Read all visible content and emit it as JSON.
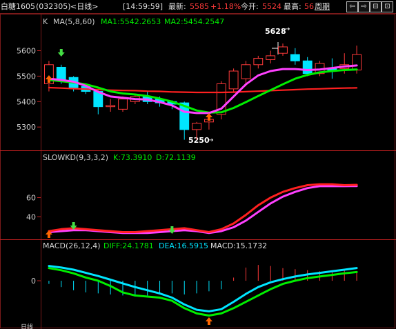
{
  "header": {
    "symbol": "白糖1605",
    "code": "(032305)",
    "period": "<日线>",
    "time": "[14:59:59]",
    "latest_label": "最新:",
    "latest_value": "5585",
    "change": "+1.18%",
    "open_label": "今开:",
    "open_value": "5524",
    "high_label": "最高:",
    "high_value": "56",
    "cycle_label": "周期",
    "nav_buttons": [
      "⇦",
      "⇨",
      "⊟",
      "⊡"
    ]
  },
  "panels": {
    "main_prefix": "K",
    "main_title": "MA(5,8,60)",
    "ma1": "MA1:5542.2653",
    "ma2": "MA2:5454.2547",
    "kd_title": "SLOWKD(9,3,3,2)",
    "kd_k": "K:73.3910",
    "kd_d": "D:72.1139",
    "macd_title": "MACD(26,12,4)",
    "macd_diff": "DIFF:24.1781",
    "macd_dea": "DEA:16.5915",
    "macd_macd": "MACD:15.1732",
    "hi_annotation": "5628",
    "lo_annotation": "5250",
    "bottom_cut_label": "日线"
  },
  "colors": {
    "up": "#ff3a3a",
    "down": "#00e5ff",
    "ma_short": "#ff40ff",
    "ma_mid": "#00ee00",
    "ma_long": "#ff2020",
    "kd_k": "#ff2020",
    "kd_d": "#ff40ff",
    "macd_diff": "#00e5ff",
    "macd_dea": "#00ee00",
    "frame": "#7a1a1a",
    "signal_buy": "#ff6600",
    "signal_sell": "#44dd44"
  },
  "chart_data": [
    {
      "type": "candlestick",
      "ylim": [
        5230,
        5680
      ],
      "yticks": [
        5300,
        5400,
        5500,
        5600
      ],
      "candles": [
        {
          "o": 5470,
          "h": 5560,
          "l": 5440,
          "c": 5545
        },
        {
          "o": 5535,
          "h": 5545,
          "l": 5470,
          "c": 5480
        },
        {
          "o": 5495,
          "h": 5500,
          "l": 5440,
          "c": 5455
        },
        {
          "o": 5460,
          "h": 5470,
          "l": 5430,
          "c": 5440
        },
        {
          "o": 5440,
          "h": 5450,
          "l": 5350,
          "c": 5380
        },
        {
          "o": 5380,
          "h": 5410,
          "l": 5360,
          "c": 5385
        },
        {
          "o": 5370,
          "h": 5420,
          "l": 5360,
          "c": 5410
        },
        {
          "o": 5400,
          "h": 5430,
          "l": 5390,
          "c": 5420
        },
        {
          "o": 5420,
          "h": 5440,
          "l": 5390,
          "c": 5400
        },
        {
          "o": 5410,
          "h": 5420,
          "l": 5380,
          "c": 5395
        },
        {
          "o": 5400,
          "h": 5405,
          "l": 5370,
          "c": 5390
        },
        {
          "o": 5395,
          "h": 5400,
          "l": 5250,
          "c": 5290
        },
        {
          "o": 5290,
          "h": 5320,
          "l": 5250,
          "c": 5315
        },
        {
          "o": 5320,
          "h": 5360,
          "l": 5290,
          "c": 5330
        },
        {
          "o": 5350,
          "h": 5480,
          "l": 5330,
          "c": 5470
        },
        {
          "o": 5450,
          "h": 5530,
          "l": 5440,
          "c": 5520
        },
        {
          "o": 5490,
          "h": 5560,
          "l": 5460,
          "c": 5545
        },
        {
          "o": 5545,
          "h": 5580,
          "l": 5530,
          "c": 5570
        },
        {
          "o": 5565,
          "h": 5600,
          "l": 5550,
          "c": 5580
        },
        {
          "o": 5590,
          "h": 5628,
          "l": 5580,
          "c": 5615
        },
        {
          "o": 5585,
          "h": 5610,
          "l": 5545,
          "c": 5560
        },
        {
          "o": 5560,
          "h": 5575,
          "l": 5500,
          "c": 5510
        },
        {
          "o": 5510,
          "h": 5560,
          "l": 5500,
          "c": 5550
        },
        {
          "o": 5530,
          "h": 5570,
          "l": 5490,
          "c": 5520
        },
        {
          "o": 5530,
          "h": 5590,
          "l": 5510,
          "c": 5545
        },
        {
          "o": 5524,
          "h": 5620,
          "l": 5510,
          "c": 5585
        }
      ],
      "ma_short": [
        5490,
        5485,
        5478,
        5462,
        5438,
        5420,
        5415,
        5410,
        5408,
        5398,
        5385,
        5360,
        5355,
        5355,
        5372,
        5420,
        5468,
        5503,
        5520,
        5528,
        5528,
        5524,
        5526,
        5532,
        5538,
        5542
      ],
      "ma_mid": [
        5485,
        5480,
        5475,
        5468,
        5455,
        5440,
        5432,
        5428,
        5422,
        5412,
        5400,
        5383,
        5365,
        5357,
        5358,
        5375,
        5398,
        5422,
        5445,
        5468,
        5490,
        5505,
        5515,
        5520,
        5524,
        5526
      ],
      "ma_long": [
        5455,
        5453,
        5451,
        5449,
        5447,
        5445,
        5444,
        5443,
        5441,
        5440,
        5438,
        5437,
        5436,
        5436,
        5436,
        5437,
        5439,
        5441,
        5443,
        5445,
        5447,
        5449,
        5450,
        5452,
        5453,
        5454
      ]
    },
    {
      "type": "line",
      "ylim": [
        20,
        95
      ],
      "yticks": [
        40,
        60
      ],
      "series": [
        {
          "name": "K",
          "values": [
            25,
            27,
            28,
            27,
            26,
            25,
            24,
            24,
            25,
            26,
            27,
            28,
            26,
            24,
            27,
            33,
            42,
            52,
            60,
            66,
            70,
            73,
            74,
            74,
            73,
            73.391
          ]
        },
        {
          "name": "D",
          "values": [
            24,
            25,
            26,
            26,
            25,
            24,
            23,
            23,
            23,
            24,
            25,
            26,
            25,
            23,
            25,
            29,
            36,
            45,
            54,
            61,
            66,
            70,
            72,
            72,
            72,
            72.1139
          ]
        }
      ]
    },
    {
      "type": "line",
      "ylim": [
        -85,
        55
      ],
      "yticks": [
        0
      ],
      "series": [
        {
          "name": "DIFF",
          "values": [
            28,
            25,
            21,
            15,
            9,
            2,
            -5,
            -12,
            -18,
            -24,
            -32,
            -45,
            -55,
            -58,
            -54,
            -40,
            -25,
            -12,
            -3,
            3,
            8,
            12,
            15,
            18,
            21,
            24.1781
          ]
        },
        {
          "name": "DEA",
          "values": [
            24,
            20,
            14,
            6,
            0,
            -10,
            -22,
            -28,
            -30,
            -32,
            -38,
            -52,
            -62,
            -66,
            -62,
            -52,
            -40,
            -28,
            -16,
            -6,
            0,
            5,
            8,
            11,
            14,
            16.5915
          ]
        },
        {
          "name": "MACD",
          "values": [
            -6,
            -12,
            -18,
            -22,
            -24,
            -26,
            -28,
            -30,
            -28,
            -26,
            -24,
            -26,
            -24,
            -20,
            -16,
            6,
            25,
            30,
            28,
            24,
            22,
            20,
            18,
            16,
            20,
            15.1732
          ]
        }
      ]
    }
  ]
}
